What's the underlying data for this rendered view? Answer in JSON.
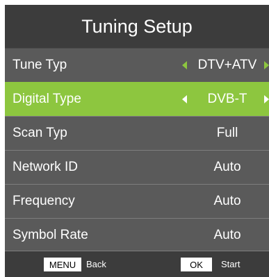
{
  "title": "Tuning Setup",
  "menu": {
    "rows": [
      {
        "label": "Tune Typ",
        "value": "DTV+ATV"
      },
      {
        "label": "Digital Type",
        "value": "DVB-T"
      },
      {
        "label": "Scan Typ",
        "value": "Full"
      },
      {
        "label": "Network ID",
        "value": "Auto"
      },
      {
        "label": "Frequency",
        "value": "Auto"
      },
      {
        "label": "Symbol Rate",
        "value": "Auto"
      }
    ],
    "selected_row": "Digital Type"
  },
  "footer": {
    "menu_key": "MENU",
    "menu_hint": "Back",
    "ok_key": "OK",
    "ok_hint": "Start"
  },
  "colors": {
    "highlight": "#8dc63f",
    "title_bar": "#3c3c3c",
    "panel": "#5a5a5a"
  },
  "icons": [
    "arrow-left-icon",
    "arrow-right-icon"
  ]
}
